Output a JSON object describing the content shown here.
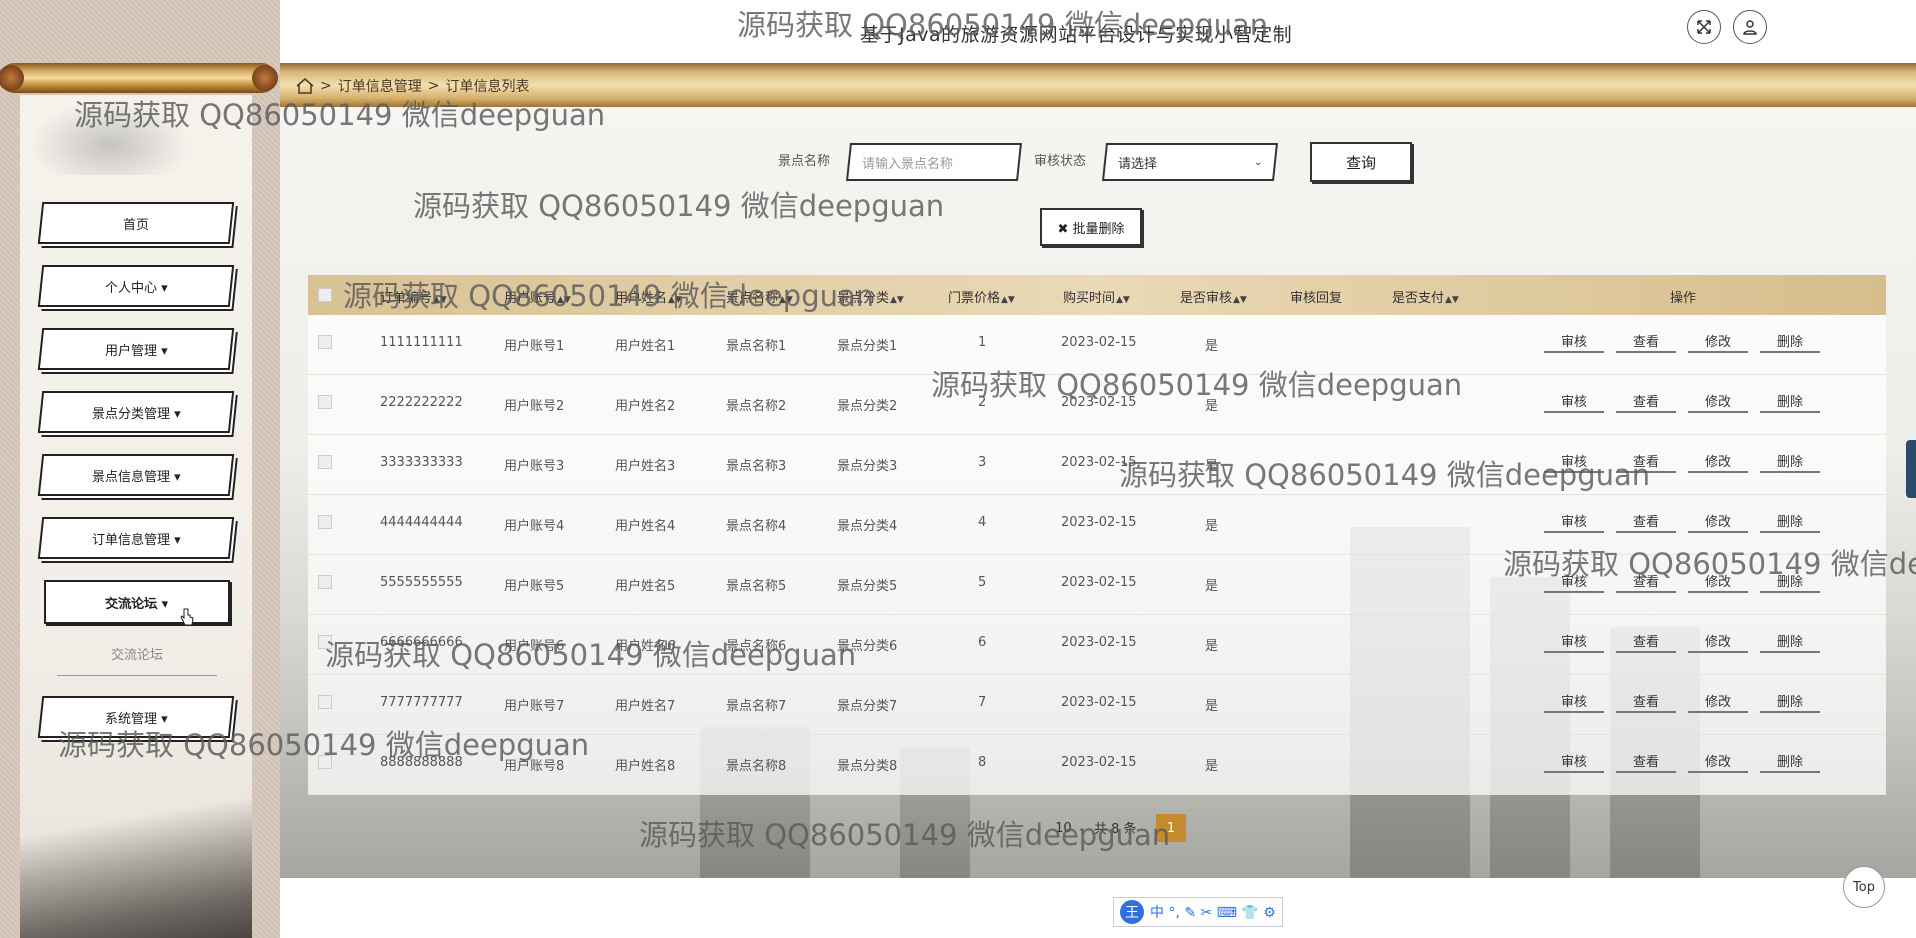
{
  "header": {
    "site_title": "基于Java的旅游资源网站平台设计与实现小智定制",
    "fullscreen_icon": "fullscreen-icon",
    "user_icon": "user-icon"
  },
  "breadcrumb": {
    "home_icon": "home-icon",
    "sep1": ">",
    "level1": "订单信息管理",
    "sep2": ">",
    "level2": "订单信息列表"
  },
  "sidebar": {
    "items": [
      {
        "label": "首页"
      },
      {
        "label": "个人中心 ▾"
      },
      {
        "label": "用户管理 ▾"
      },
      {
        "label": "景点分类管理 ▾"
      },
      {
        "label": "景点信息管理 ▾"
      },
      {
        "label": "订单信息管理 ▾"
      },
      {
        "label": "交流论坛 ▾"
      },
      {
        "label": "系统管理 ▾"
      }
    ],
    "submenu": "交流论坛"
  },
  "search": {
    "name_label": "景点名称",
    "name_placeholder": "请输入景点名称",
    "status_label": "审核状态",
    "status_value": "请选择",
    "query_button": "查询",
    "batch_delete_button": "✖ 批量删除"
  },
  "table": {
    "headers": [
      "订单编号",
      "用户账号",
      "用户姓名",
      "景点名称",
      "景点分类",
      "门票价格",
      "购买时间",
      "是否审核",
      "审核回复",
      "是否支付",
      "操作"
    ],
    "sort_icon": "sort-icon",
    "actions": [
      "审核",
      "查看",
      "修改",
      "删除"
    ],
    "rows": [
      {
        "order_no": "1111111111",
        "account": "用户账号1",
        "name": "用户姓名1",
        "spot": "景点名称1",
        "category": "景点分类1",
        "price": "1",
        "time": "2023-02-15",
        "audited": "是"
      },
      {
        "order_no": "2222222222",
        "account": "用户账号2",
        "name": "用户姓名2",
        "spot": "景点名称2",
        "category": "景点分类2",
        "price": "2",
        "time": "2023-02-15",
        "audited": "是"
      },
      {
        "order_no": "3333333333",
        "account": "用户账号3",
        "name": "用户姓名3",
        "spot": "景点名称3",
        "category": "景点分类3",
        "price": "3",
        "time": "2023-02-15",
        "audited": "是"
      },
      {
        "order_no": "4444444444",
        "account": "用户账号4",
        "name": "用户姓名4",
        "spot": "景点名称4",
        "category": "景点分类4",
        "price": "4",
        "time": "2023-02-15",
        "audited": "是"
      },
      {
        "order_no": "5555555555",
        "account": "用户账号5",
        "name": "用户姓名5",
        "spot": "景点名称5",
        "category": "景点分类5",
        "price": "5",
        "time": "2023-02-15",
        "audited": "是"
      },
      {
        "order_no": "6666666666",
        "account": "用户账号6",
        "name": "用户姓名6",
        "spot": "景点名称6",
        "category": "景点分类6",
        "price": "6",
        "time": "2023-02-15",
        "audited": "是"
      },
      {
        "order_no": "7777777777",
        "account": "用户账号7",
        "name": "用户姓名7",
        "spot": "景点名称7",
        "category": "景点分类7",
        "price": "7",
        "time": "2023-02-15",
        "audited": "是"
      },
      {
        "order_no": "8888888888",
        "account": "用户账号8",
        "name": "用户姓名8",
        "spot": "景点名称8",
        "category": "景点分类8",
        "price": "8",
        "time": "2023-02-15",
        "audited": "是"
      }
    ]
  },
  "pagination": {
    "page_size": "10",
    "total": "共 8 条",
    "current_page": "1"
  },
  "floating": {
    "top_button": "Top",
    "ime_logo": "王",
    "ime_tools": "中 °, ✎ ✂ ⌨ 👕 ⚙"
  },
  "watermark": {
    "text": "源码获取 QQ86050149 微信deepguan",
    "text_cut": "源码获取 QQ86050149 微信de"
  },
  "colors": {
    "accent_gold": "#c48a2c",
    "header_band": "#d8c294",
    "border_dark": "#222222"
  }
}
